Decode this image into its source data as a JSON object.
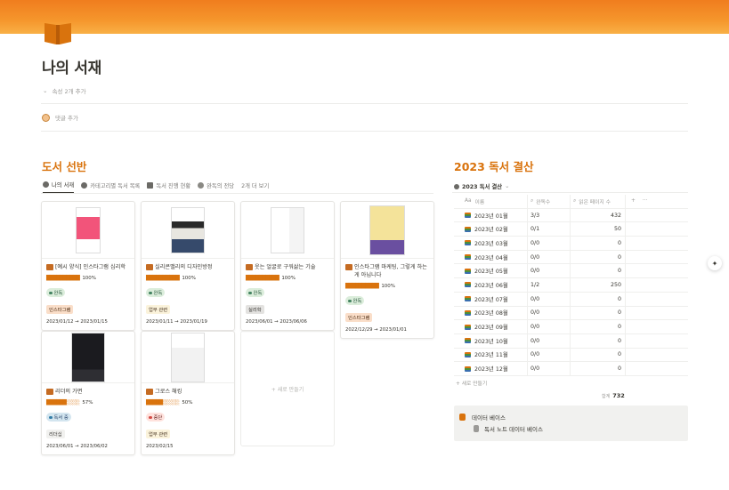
{
  "page": {
    "title": "나의 서재",
    "properties_toggle": "속성 2개 추가",
    "comment_placeholder": "댓글 추가"
  },
  "shelf": {
    "title": "도서 선반",
    "tabs": [
      {
        "label": "나의 서재",
        "active": true
      },
      {
        "label": "카테고리별 독서 목록"
      },
      {
        "label": "독서 진행 현황"
      },
      {
        "label": "완독의 전당"
      },
      {
        "label": "2개 더 보기"
      }
    ],
    "cards": [
      {
        "title": "[예시 양식] 인스타그램 심리학",
        "progress_bar": "██████████",
        "progress": "100%",
        "status": "완독",
        "tag": "인스타그램",
        "dates": "2023/01/12 → 2023/01/15"
      },
      {
        "title": "실리콘밸리의 디자인방정",
        "progress_bar": "██████████",
        "progress": "100%",
        "status": "완독",
        "tag": "업무 관련",
        "dates": "2023/01/11 → 2023/01/19"
      },
      {
        "title": "웃는 얼굴로 구워삶는 기술",
        "progress_bar": "██████████",
        "progress": "100%",
        "status": "완독",
        "tag": "실리학",
        "dates": "2023/06/01 → 2023/06/06"
      },
      {
        "title": "인스타그램 마케팅, 그렇게 하는 게 아닙니다",
        "progress_bar": "██████████",
        "progress": "100%",
        "status": "완독",
        "tag": "인스타그램",
        "dates": "2022/12/29 → 2023/01/01"
      },
      {
        "title": "리더의 가면",
        "progress_bar": "██████░░░░",
        "progress": "57%",
        "status": "독서 중",
        "tag": "리더십",
        "dates": "2023/06/01 → 2023/06/02"
      },
      {
        "title": "그로스 해킹",
        "progress_bar": "█████░░░░░",
        "progress": "50%",
        "status": "중단",
        "tag": "업무 관련",
        "dates": "2023/02/15"
      }
    ],
    "new_card": "+ 새로 만들기"
  },
  "summary": {
    "title": "2023 독서 결산",
    "tab": "2023 독서 결산",
    "headers": {
      "name": "이름",
      "done": "완독수",
      "pages": "읽은 페이지 수",
      "add": "+",
      "more": "···"
    },
    "rows": [
      {
        "name": "2023년 01월",
        "done": "3/3",
        "pages": "432"
      },
      {
        "name": "2023년 02월",
        "done": "0/1",
        "pages": "50"
      },
      {
        "name": "2023년 03월",
        "done": "0/0",
        "pages": "0"
      },
      {
        "name": "2023년 04월",
        "done": "0/0",
        "pages": "0"
      },
      {
        "name": "2023년 05월",
        "done": "0/0",
        "pages": "0"
      },
      {
        "name": "2023년 06월",
        "done": "1/2",
        "pages": "250"
      },
      {
        "name": "2023년 07월",
        "done": "0/0",
        "pages": "0"
      },
      {
        "name": "2023년 08월",
        "done": "0/0",
        "pages": "0"
      },
      {
        "name": "2023년 09월",
        "done": "0/0",
        "pages": "0"
      },
      {
        "name": "2023년 10월",
        "done": "0/0",
        "pages": "0"
      },
      {
        "name": "2023년 11월",
        "done": "0/0",
        "pages": "0"
      },
      {
        "name": "2023년 12월",
        "done": "0/0",
        "pages": "0"
      }
    ],
    "new_row": "+ 새로 만들기",
    "sum_label": "합계",
    "sum_value": "732"
  },
  "database": {
    "heading": "데이터 베이스",
    "item": "독서 노트 데이터 베이스"
  }
}
